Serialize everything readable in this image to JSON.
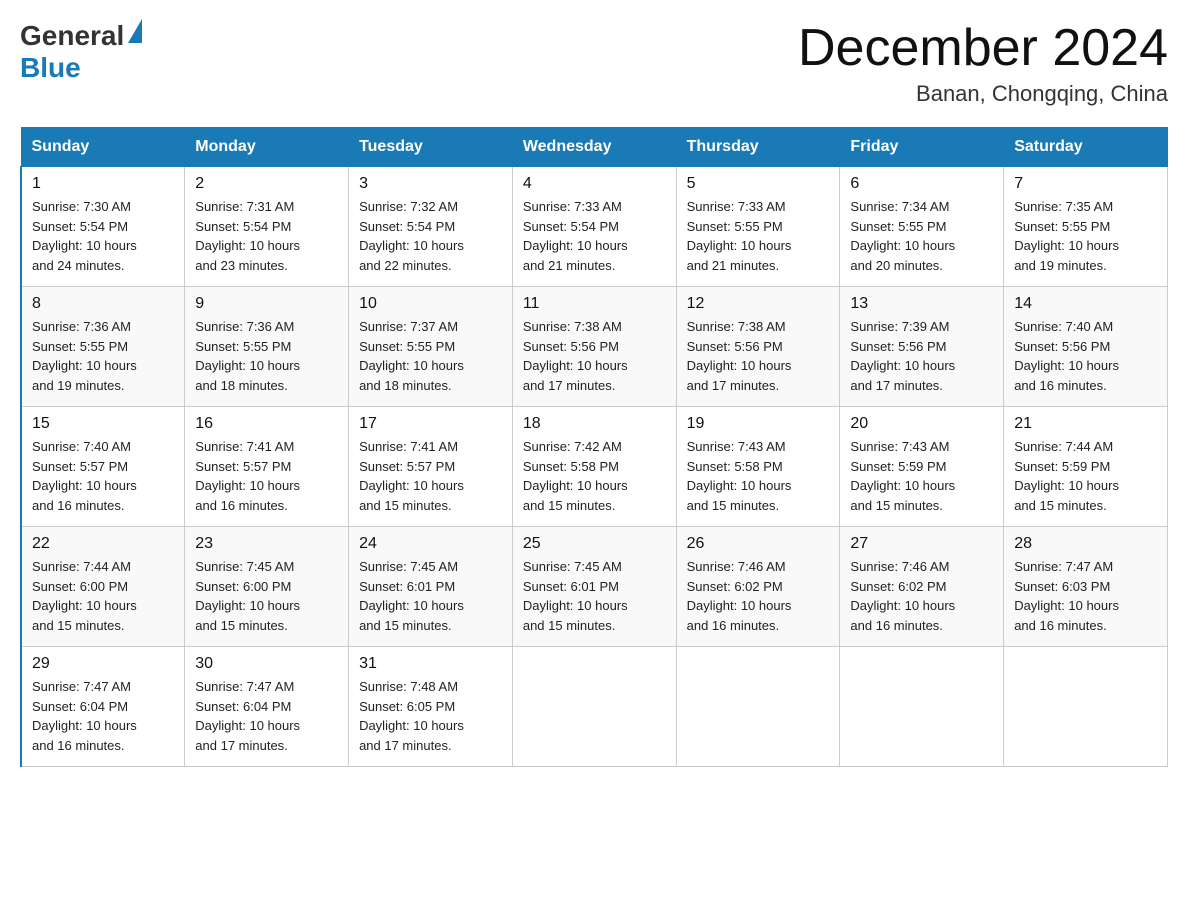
{
  "header": {
    "logo_general": "General",
    "logo_blue": "Blue",
    "month_title": "December 2024",
    "subtitle": "Banan, Chongqing, China"
  },
  "days_of_week": [
    "Sunday",
    "Monday",
    "Tuesday",
    "Wednesday",
    "Thursday",
    "Friday",
    "Saturday"
  ],
  "weeks": [
    [
      {
        "day": "1",
        "sunrise": "7:30 AM",
        "sunset": "5:54 PM",
        "daylight": "10 hours and 24 minutes."
      },
      {
        "day": "2",
        "sunrise": "7:31 AM",
        "sunset": "5:54 PM",
        "daylight": "10 hours and 23 minutes."
      },
      {
        "day": "3",
        "sunrise": "7:32 AM",
        "sunset": "5:54 PM",
        "daylight": "10 hours and 22 minutes."
      },
      {
        "day": "4",
        "sunrise": "7:33 AM",
        "sunset": "5:54 PM",
        "daylight": "10 hours and 21 minutes."
      },
      {
        "day": "5",
        "sunrise": "7:33 AM",
        "sunset": "5:55 PM",
        "daylight": "10 hours and 21 minutes."
      },
      {
        "day": "6",
        "sunrise": "7:34 AM",
        "sunset": "5:55 PM",
        "daylight": "10 hours and 20 minutes."
      },
      {
        "day": "7",
        "sunrise": "7:35 AM",
        "sunset": "5:55 PM",
        "daylight": "10 hours and 19 minutes."
      }
    ],
    [
      {
        "day": "8",
        "sunrise": "7:36 AM",
        "sunset": "5:55 PM",
        "daylight": "10 hours and 19 minutes."
      },
      {
        "day": "9",
        "sunrise": "7:36 AM",
        "sunset": "5:55 PM",
        "daylight": "10 hours and 18 minutes."
      },
      {
        "day": "10",
        "sunrise": "7:37 AM",
        "sunset": "5:55 PM",
        "daylight": "10 hours and 18 minutes."
      },
      {
        "day": "11",
        "sunrise": "7:38 AM",
        "sunset": "5:56 PM",
        "daylight": "10 hours and 17 minutes."
      },
      {
        "day": "12",
        "sunrise": "7:38 AM",
        "sunset": "5:56 PM",
        "daylight": "10 hours and 17 minutes."
      },
      {
        "day": "13",
        "sunrise": "7:39 AM",
        "sunset": "5:56 PM",
        "daylight": "10 hours and 17 minutes."
      },
      {
        "day": "14",
        "sunrise": "7:40 AM",
        "sunset": "5:56 PM",
        "daylight": "10 hours and 16 minutes."
      }
    ],
    [
      {
        "day": "15",
        "sunrise": "7:40 AM",
        "sunset": "5:57 PM",
        "daylight": "10 hours and 16 minutes."
      },
      {
        "day": "16",
        "sunrise": "7:41 AM",
        "sunset": "5:57 PM",
        "daylight": "10 hours and 16 minutes."
      },
      {
        "day": "17",
        "sunrise": "7:41 AM",
        "sunset": "5:57 PM",
        "daylight": "10 hours and 15 minutes."
      },
      {
        "day": "18",
        "sunrise": "7:42 AM",
        "sunset": "5:58 PM",
        "daylight": "10 hours and 15 minutes."
      },
      {
        "day": "19",
        "sunrise": "7:43 AM",
        "sunset": "5:58 PM",
        "daylight": "10 hours and 15 minutes."
      },
      {
        "day": "20",
        "sunrise": "7:43 AM",
        "sunset": "5:59 PM",
        "daylight": "10 hours and 15 minutes."
      },
      {
        "day": "21",
        "sunrise": "7:44 AM",
        "sunset": "5:59 PM",
        "daylight": "10 hours and 15 minutes."
      }
    ],
    [
      {
        "day": "22",
        "sunrise": "7:44 AM",
        "sunset": "6:00 PM",
        "daylight": "10 hours and 15 minutes."
      },
      {
        "day": "23",
        "sunrise": "7:45 AM",
        "sunset": "6:00 PM",
        "daylight": "10 hours and 15 minutes."
      },
      {
        "day": "24",
        "sunrise": "7:45 AM",
        "sunset": "6:01 PM",
        "daylight": "10 hours and 15 minutes."
      },
      {
        "day": "25",
        "sunrise": "7:45 AM",
        "sunset": "6:01 PM",
        "daylight": "10 hours and 15 minutes."
      },
      {
        "day": "26",
        "sunrise": "7:46 AM",
        "sunset": "6:02 PM",
        "daylight": "10 hours and 16 minutes."
      },
      {
        "day": "27",
        "sunrise": "7:46 AM",
        "sunset": "6:02 PM",
        "daylight": "10 hours and 16 minutes."
      },
      {
        "day": "28",
        "sunrise": "7:47 AM",
        "sunset": "6:03 PM",
        "daylight": "10 hours and 16 minutes."
      }
    ],
    [
      {
        "day": "29",
        "sunrise": "7:47 AM",
        "sunset": "6:04 PM",
        "daylight": "10 hours and 16 minutes."
      },
      {
        "day": "30",
        "sunrise": "7:47 AM",
        "sunset": "6:04 PM",
        "daylight": "10 hours and 17 minutes."
      },
      {
        "day": "31",
        "sunrise": "7:48 AM",
        "sunset": "6:05 PM",
        "daylight": "10 hours and 17 minutes."
      },
      null,
      null,
      null,
      null
    ]
  ],
  "sunrise_label": "Sunrise:",
  "sunset_label": "Sunset:",
  "daylight_label": "Daylight:"
}
